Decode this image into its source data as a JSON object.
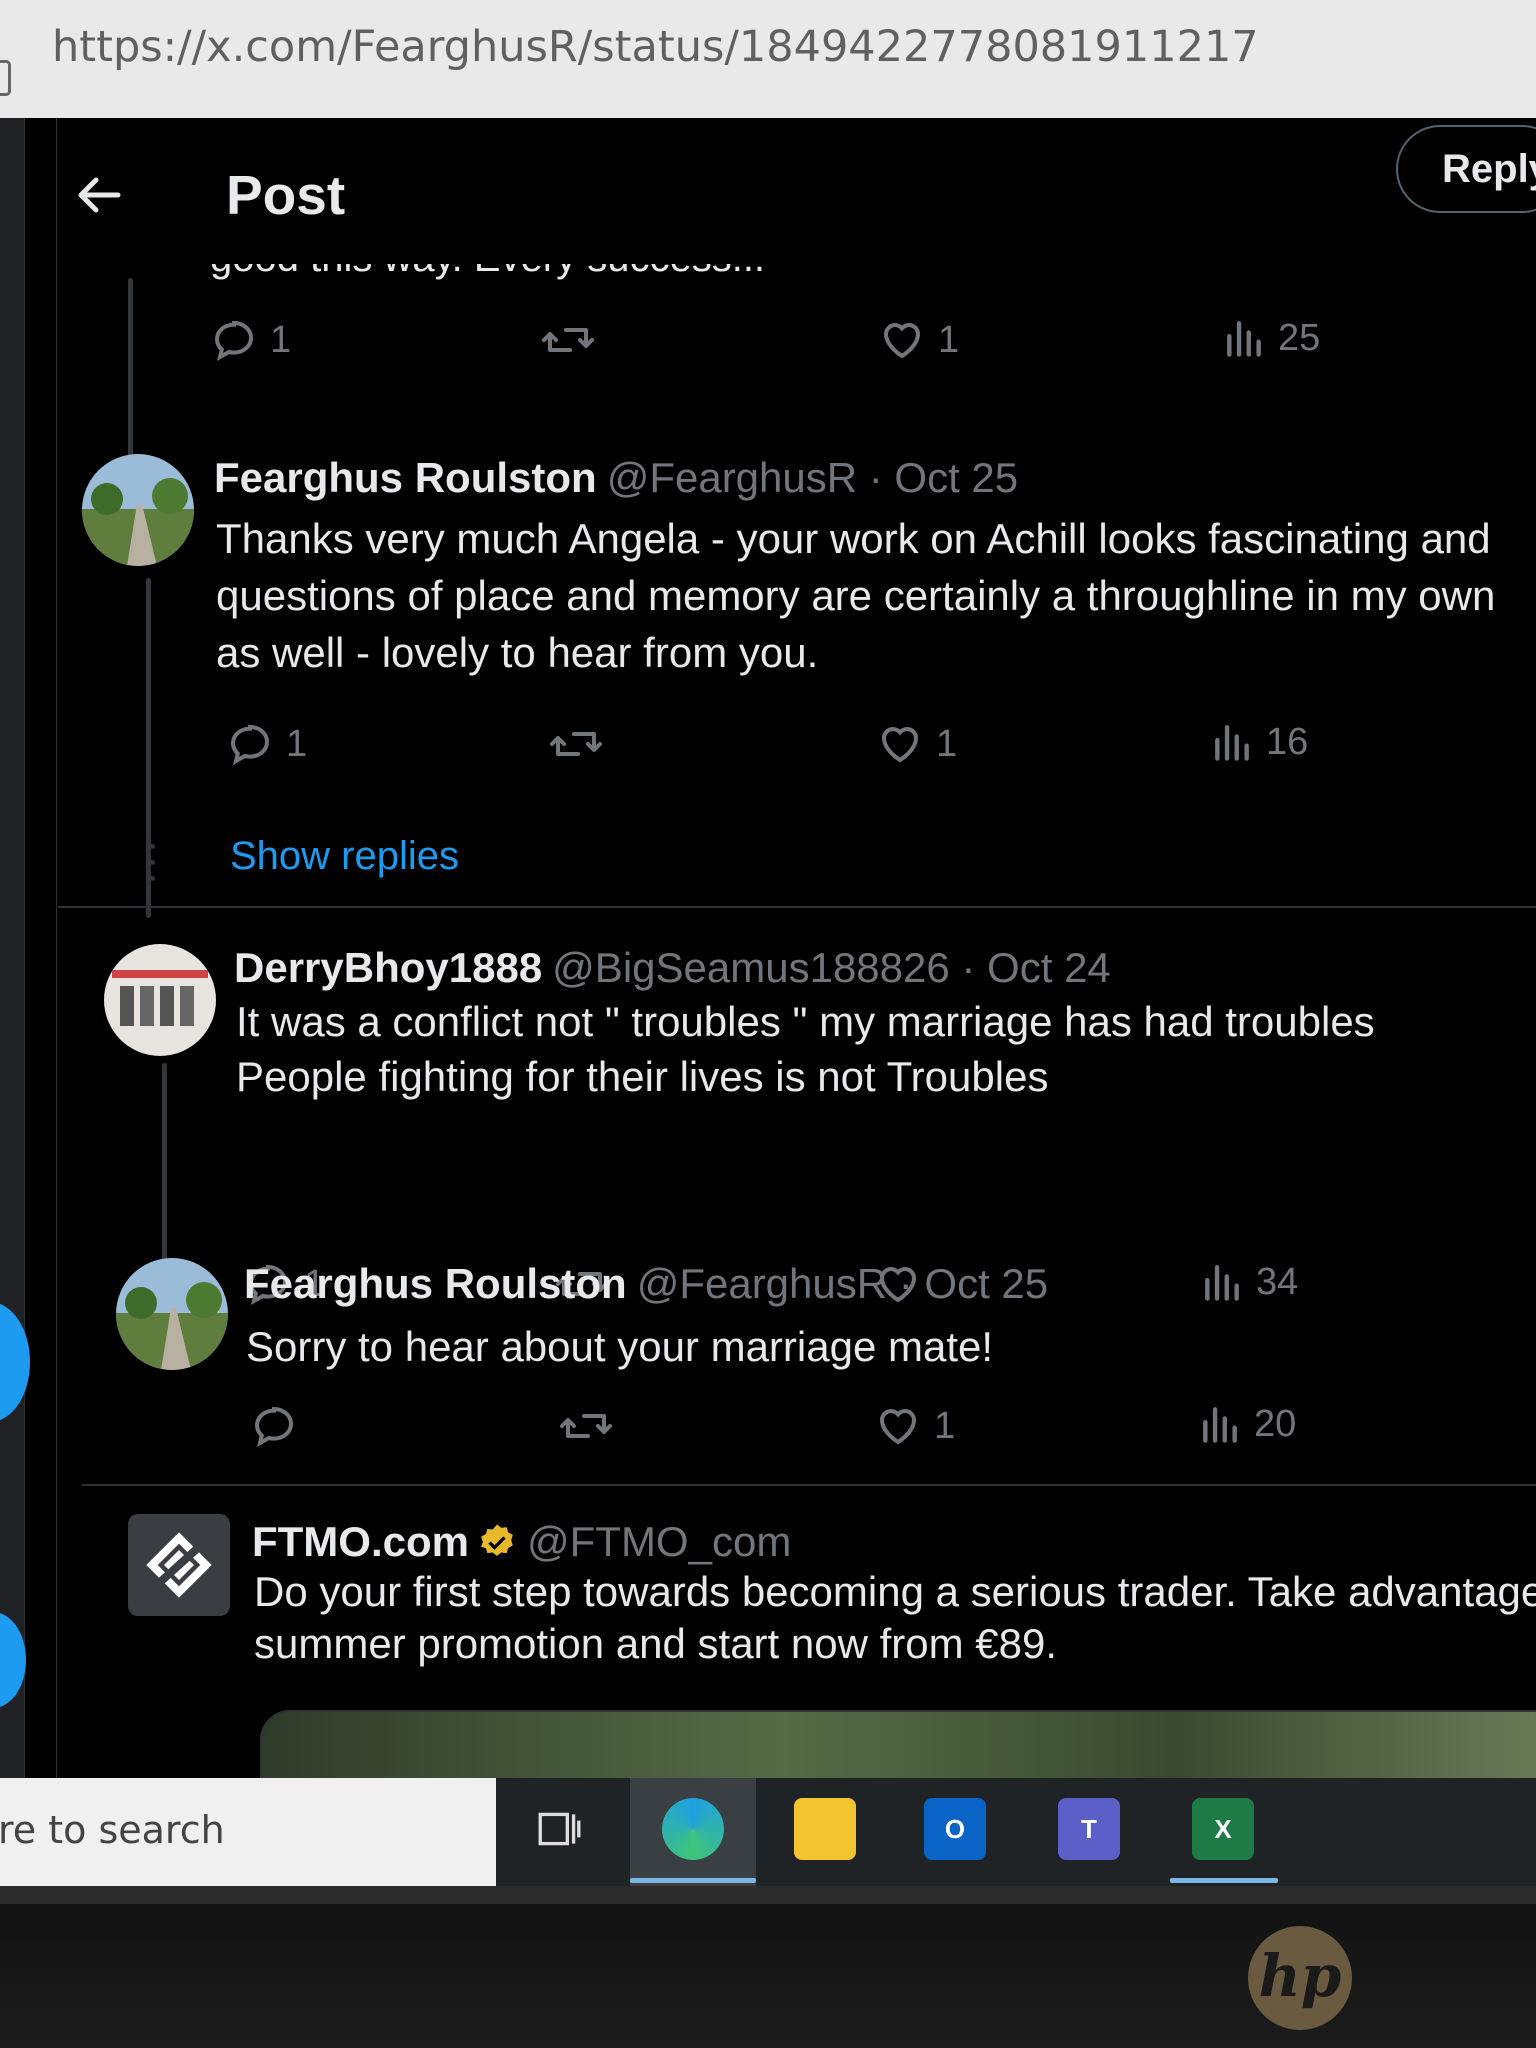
{
  "browser": {
    "url": "https://x.com/FearghusR/status/1849422778081911217"
  },
  "header": {
    "title": "Post",
    "reply_button": "Reply"
  },
  "partial_text": "good this way. Every success...",
  "top_actions": {
    "replies": "1",
    "reposts": "",
    "likes": "1",
    "views": "25"
  },
  "tweets": [
    {
      "name": "Fearghus Roulston",
      "handle": "@FearghusR · Oct 25",
      "lines": [
        "Thanks very much Angela - your work on Achill looks fascinating and",
        "questions of place and memory are certainly a throughline in my own",
        "as well - lovely to hear from you."
      ],
      "replies": "1",
      "reposts": "",
      "likes": "1",
      "views": "16"
    },
    {
      "name": "DerryBhoy1888",
      "handle": "@BigSeamus188826 · Oct 24",
      "lines": [
        "It was a conflict not \" troubles \"  my marriage has had troubles",
        "People fighting for their lives is not Troubles"
      ],
      "replies": "1",
      "reposts": "",
      "likes": "",
      "views": "34"
    },
    {
      "name": "Fearghus Roulston",
      "handle": "@FearghusR · Oct 25",
      "lines": [
        "Sorry to hear about your marriage mate!"
      ],
      "replies": "",
      "reposts": "",
      "likes": "1",
      "views": "20"
    }
  ],
  "show_replies": "Show replies",
  "ad": {
    "name": "FTMO.com",
    "handle": "@FTMO_com",
    "lines": [
      "Do your first step towards becoming a serious trader. Take advantage",
      "summer promotion and start now from €89."
    ]
  },
  "taskbar": {
    "search_placeholder": "re to search",
    "apps": [
      "task-view",
      "edge",
      "file-explorer",
      "outlook",
      "teams",
      "excel"
    ],
    "outlook_letter": "O",
    "teams_letter": "T",
    "excel_letter": "X"
  },
  "monitor": {
    "brand": "hp"
  },
  "colors": {
    "accent": "#1d9bf0",
    "background": "#000000",
    "muted": "#71767b"
  }
}
